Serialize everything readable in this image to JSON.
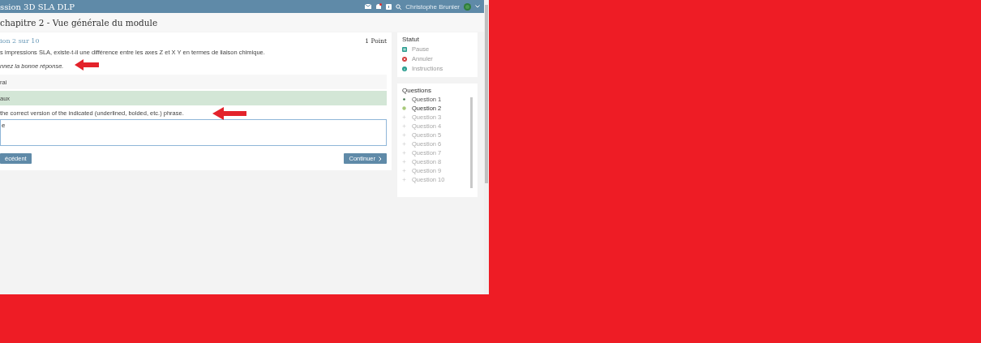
{
  "header": {
    "title": "ssion 3D SLA DLP",
    "user": "Christophe Brunier",
    "notification_badge": true
  },
  "page_title": "chapitre 2 - Vue générale du module",
  "question": {
    "heading": "ion 2 sur 10",
    "points": "1 Point",
    "text": "s impressions SLA, existe-t-il une différence entre les axes Z et X Y en termes de liaison chimique.",
    "instruction": "nnez la bonne réponse.",
    "options": [
      {
        "label": "rai",
        "selected": false
      },
      {
        "label": "aux",
        "selected": true
      }
    ],
    "prompt": "the correct version of the indicated (underlined, bolded, etc.) phrase.",
    "answer": "e",
    "buttons": [
      {
        "label": "écédent",
        "kind": "back"
      },
      {
        "label": "Continuer",
        "kind": "next"
      }
    ]
  },
  "status": {
    "title": "Statut",
    "items": [
      {
        "label": "Pause",
        "kind": "pause"
      },
      {
        "label": "Annuler",
        "kind": "cancel"
      },
      {
        "label": "Instructions",
        "kind": "info"
      }
    ]
  },
  "questions": {
    "title": "Questions",
    "items": [
      {
        "label": "Question 1",
        "answered": true,
        "selected": false
      },
      {
        "label": "Question 2",
        "answered": true,
        "selected": true
      },
      {
        "label": "Question 3",
        "answered": false,
        "selected": false
      },
      {
        "label": "Question 4",
        "answered": false,
        "selected": false
      },
      {
        "label": "Question 5",
        "answered": false,
        "selected": false
      },
      {
        "label": "Question 6",
        "answered": false,
        "selected": false
      },
      {
        "label": "Question 7",
        "answered": false,
        "selected": false
      },
      {
        "label": "Question 8",
        "answered": false,
        "selected": false
      },
      {
        "label": "Question 9",
        "answered": false,
        "selected": false
      },
      {
        "label": "Question 10",
        "answered": false,
        "selected": false
      }
    ]
  }
}
